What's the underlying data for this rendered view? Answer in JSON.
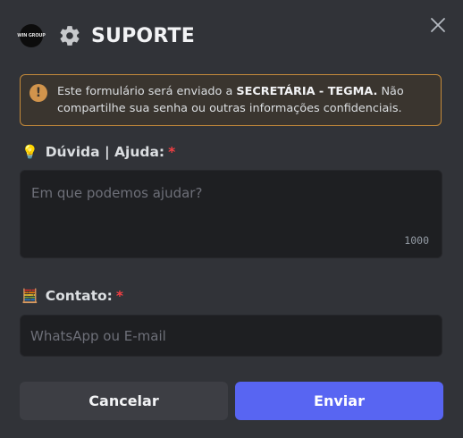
{
  "header": {
    "logo_text": "WIN GROUP",
    "title": "SUPORTE",
    "gear_icon": "gear-icon",
    "close_icon": "close-icon"
  },
  "notice": {
    "icon": "warning-icon",
    "icon_glyph": "!",
    "text_before": "Este formulário será enviado a ",
    "text_bold": "SECRETÁRIA - TEGMA.",
    "text_after": " Não compartilhe sua senha ou outras informações confidenciais.",
    "border_color": "#c48a3a"
  },
  "question": {
    "emoji": "💡",
    "label": "Dúvida | Ajuda:",
    "required_mark": "*",
    "placeholder": "Em que podemos ajudar?",
    "value": "",
    "counter": "1000"
  },
  "contact": {
    "emoji": "🧮",
    "label": "Contato:",
    "required_mark": "*",
    "placeholder": "WhatsApp ou E-mail",
    "value": ""
  },
  "buttons": {
    "cancel_label": "Cancelar",
    "send_label": "Enviar",
    "send_color": "#5865f2"
  }
}
